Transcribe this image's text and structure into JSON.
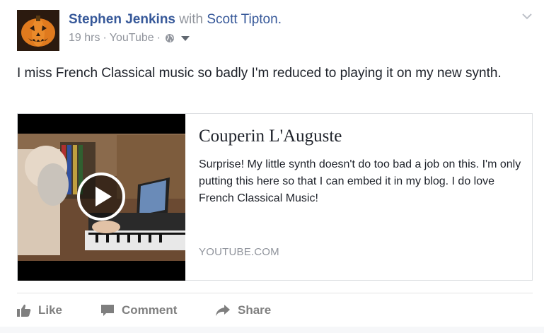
{
  "post": {
    "author": "Stephen Jenkins",
    "with_text": "with",
    "tagged": "Scott Tipton.",
    "time": "19 hrs",
    "separator": "·",
    "source": "YouTube",
    "audience_icon": "globe-icon",
    "message": "I miss French Classical music so badly I'm reduced to playing it on my new synth."
  },
  "link_preview": {
    "title": "Couperin L'Auguste",
    "description": "Surprise! My little synth doesn't do too bad a job on this. I'm only putting this here so that I can embed it in my blog. I do love French Classical Music!",
    "domain": "YOUTUBE.COM",
    "thumbnail_icon": "play-icon"
  },
  "actions": {
    "like": "Like",
    "comment": "Comment",
    "share": "Share"
  },
  "colors": {
    "link_blue": "#365899",
    "meta_gray": "#90949c",
    "action_gray": "#7f7f7f"
  }
}
